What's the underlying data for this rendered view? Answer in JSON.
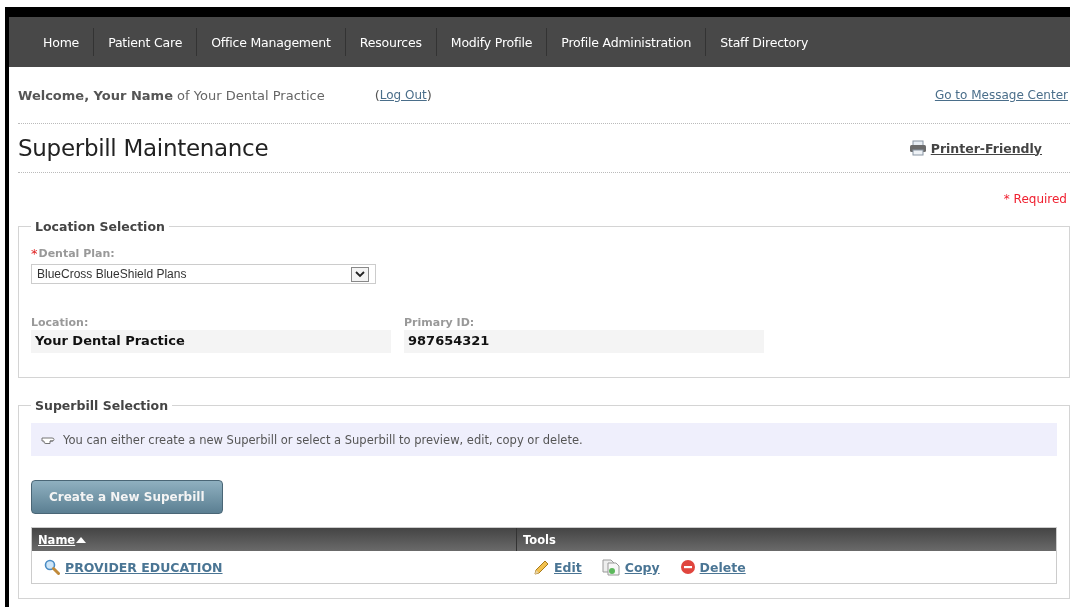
{
  "nav": [
    {
      "label": "Home"
    },
    {
      "label": "Patient Care"
    },
    {
      "label": "Office Management"
    },
    {
      "label": "Resources"
    },
    {
      "label": "Modify Profile"
    },
    {
      "label": "Profile Administration"
    },
    {
      "label": "Staff Directory"
    }
  ],
  "welcome": {
    "text": "**Welcome, Your Name** of Your Dental Practice",
    "logout": "Log Out",
    "open_paren": "(",
    "close_paren": ")",
    "message_center": "Go to Message Center"
  },
  "page_title": "Superbill Maintenance",
  "printer_friendly": "Printer-Friendly",
  "required_note": "* Required",
  "location_selection": {
    "legend": "Location Selection",
    "dental_plan": {
      "label": "Dental Plan:",
      "required": true,
      "required_mark": "*",
      "value": "BlueCross BlueShield Plans"
    },
    "location": {
      "label": "Location:",
      "value": "Your Dental Practice"
    },
    "primary_id": {
      "label": "Primary ID:",
      "value": "987654321"
    }
  },
  "superbill_selection": {
    "legend": "Superbill Selection",
    "hint": "You can either create a new Superbill or select a Superbill to preview, edit, copy or delete.",
    "create_button": "Create a New Superbill",
    "table": {
      "columns": [
        {
          "label": "Name",
          "sorted": true
        },
        {
          "label": "Tools",
          "sorted": false
        }
      ],
      "rows": [
        {
          "name": "PROVIDER EDUCATION",
          "tools": [
            {
              "kind": "edit",
              "label": "Edit"
            },
            {
              "kind": "copy",
              "label": "Copy"
            },
            {
              "kind": "delete",
              "label": "Delete"
            }
          ]
        }
      ]
    }
  }
}
